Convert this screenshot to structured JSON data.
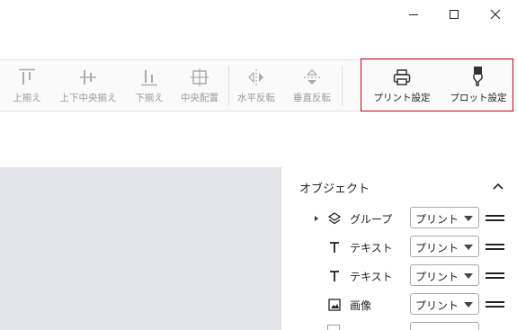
{
  "window": {
    "minimize_icon": "minimize-icon",
    "maximize_icon": "maximize-icon",
    "close_icon": "close-icon"
  },
  "toolbar": {
    "tools": [
      {
        "label": "上揃え",
        "icon": "align-top-icon",
        "enabled": false
      },
      {
        "label": "上下中央揃え",
        "icon": "align-middle-icon",
        "enabled": false
      },
      {
        "label": "下揃え",
        "icon": "align-bottom-icon",
        "enabled": false
      },
      {
        "label": "中央配置",
        "icon": "center-icon",
        "enabled": false
      },
      {
        "label": "水平反転",
        "icon": "flip-horizontal-icon",
        "enabled": false
      },
      {
        "label": "垂直反転",
        "icon": "flip-vertical-icon",
        "enabled": false
      },
      {
        "label": "プリント設定",
        "icon": "printer-icon",
        "enabled": true
      },
      {
        "label": "プロット設定",
        "icon": "plotter-pen-icon",
        "enabled": true
      }
    ],
    "highlight_color": "#d0021b"
  },
  "canvas": {
    "background": "#e2e4e9"
  },
  "objects_panel": {
    "title": "オブジェクト",
    "collapse_icon": "chevron-up-icon",
    "rows": [
      {
        "icon": "layers-icon",
        "label": "グループ",
        "mode": "プリント",
        "expandable": true
      },
      {
        "icon": "text-icon",
        "label": "テキスト",
        "mode": "プリント",
        "expandable": false
      },
      {
        "icon": "text-icon",
        "label": "テキスト",
        "mode": "プリント",
        "expandable": false
      },
      {
        "icon": "image-icon",
        "label": "画像",
        "mode": "プリント",
        "expandable": false
      }
    ]
  }
}
